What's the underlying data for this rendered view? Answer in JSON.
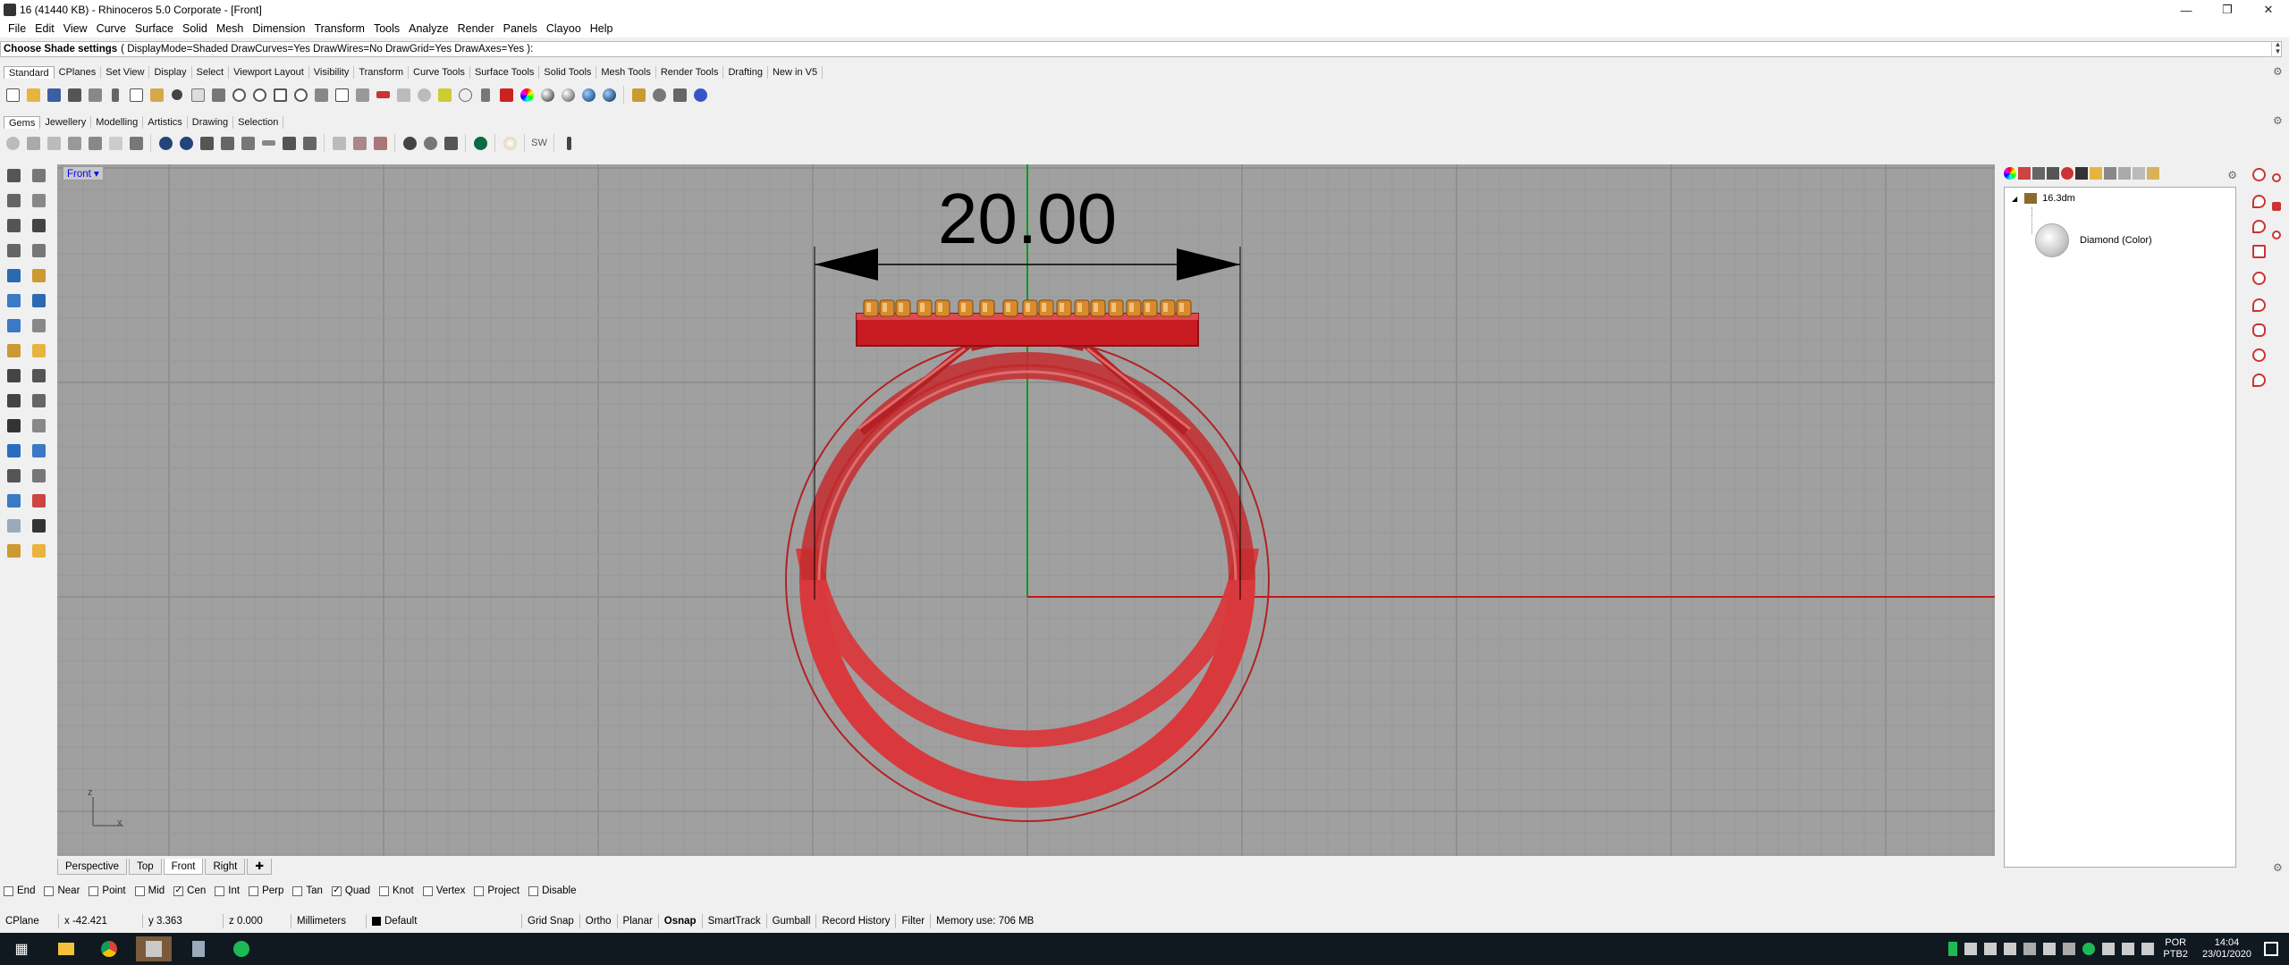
{
  "window": {
    "title": "16 (41440 KB) - Rhinoceros  5.0 Corporate - [Front]",
    "controls": [
      "minimize-icon",
      "restore-icon",
      "close-icon"
    ]
  },
  "menu": [
    "File",
    "Edit",
    "View",
    "Curve",
    "Surface",
    "Solid",
    "Mesh",
    "Dimension",
    "Transform",
    "Tools",
    "Analyze",
    "Render",
    "Panels",
    "Clayoo",
    "Help"
  ],
  "command": {
    "prompt": "Choose Shade settings",
    "options": "( DisplayMode=Shaded  DrawCurves=Yes  DrawWires=No  DrawGrid=Yes  DrawAxes=Yes ):"
  },
  "toolbar_tabs_1": [
    "Standard",
    "CPlanes",
    "Set View",
    "Display",
    "Select",
    "Viewport Layout",
    "Visibility",
    "Transform",
    "Curve Tools",
    "Surface Tools",
    "Solid Tools",
    "Mesh Tools",
    "Render Tools",
    "Drafting",
    "New in V5"
  ],
  "toolbar_tabs_2": [
    "Gems",
    "Jewellery",
    "Modelling",
    "Artistics",
    "Drawing",
    "Selection"
  ],
  "toolbar2_sw": "SW",
  "viewport": {
    "name": "Front",
    "dimension_value": "20.00",
    "axis_z": "z",
    "axis_x": "x"
  },
  "viewport_tabs": [
    "Perspective",
    "Top",
    "Front",
    "Right"
  ],
  "active_viewport_tab": "Front",
  "osnap": [
    {
      "label": "End",
      "checked": false
    },
    {
      "label": "Near",
      "checked": false
    },
    {
      "label": "Point",
      "checked": false
    },
    {
      "label": "Mid",
      "checked": false
    },
    {
      "label": "Cen",
      "checked": true
    },
    {
      "label": "Int",
      "checked": false
    },
    {
      "label": "Perp",
      "checked": false
    },
    {
      "label": "Tan",
      "checked": false
    },
    {
      "label": "Quad",
      "checked": true
    },
    {
      "label": "Knot",
      "checked": false
    },
    {
      "label": "Vertex",
      "checked": false
    },
    {
      "label": "Project",
      "checked": false
    },
    {
      "label": "Disable",
      "checked": false
    }
  ],
  "status": {
    "cplane": "CPlane",
    "x": "x -42.421",
    "y": "y 3.363",
    "z": "z 0.000",
    "units": "Millimeters",
    "layer": "Default",
    "buttons": [
      "Grid Snap",
      "Ortho",
      "Planar",
      "Osnap",
      "SmartTrack",
      "Gumball",
      "Record History",
      "Filter"
    ],
    "memory": "Memory use: 706 MB"
  },
  "layers": {
    "file": "16.3dm",
    "item": "Diamond (Color)"
  },
  "taskbar": {
    "lang": "POR",
    "layout": "PTB2",
    "time": "14:04",
    "date": "23/01/2020"
  },
  "colors": {
    "ring_red": "#d9393c",
    "gem_orange": "#d98a2b",
    "viewport_bg": "#a0a0a0",
    "grid_line": "#8c8c8c",
    "axis_green": "#0a9a1a",
    "axis_red": "#c41818"
  }
}
